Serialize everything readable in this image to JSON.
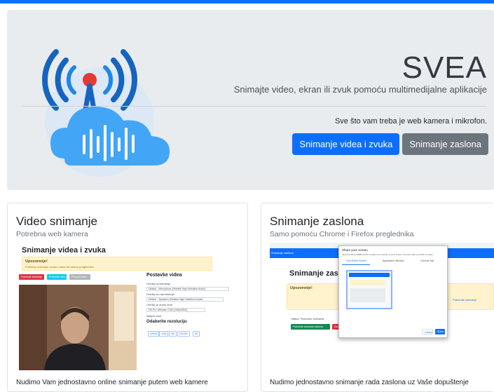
{
  "hero": {
    "title": "SVEA",
    "lead": "Snimajte video, ekran ili zvuk pomoću multimedijalne aplikacije",
    "text": "Sve što vam treba je web kamera i mikrofon.",
    "buttons": {
      "video_audio": "Snimanje videa i zvuka",
      "screen": "Snimanje zaslona"
    }
  },
  "cards": {
    "video": {
      "title": "Video snimanje",
      "subtitle": "Potrebna web kamera",
      "text": "Nudimo Vam jednostavno online snimanje putem web kamere",
      "preview": {
        "heading": "Snimanje videa i zvuka",
        "alert_title": "Upozorenje!",
        "alert_text": "Potrebno snimanje zvuka i videa na vašem pregledniku",
        "buttons": [
          "Pokrenite snimanje",
          "Pokrenite video",
          "Preuzmi video"
        ],
        "settings_title": "Postavke videa",
        "labels": [
          "Uređaj za snimanje",
          "Uređaj za reprodukciju",
          "Uređaj za audio izvor"
        ],
        "selects": [
          "Default - Microphone (Realtek High Definition Audio)",
          "Default - Speakers (Realtek High Definition Audio)",
          "HD Pro Webcam C920 (046d:082d)"
        ],
        "checkbox_label": "Isključi zvuk",
        "resolution_title": "Odaberite rezoluciju",
        "resolutions": [
          "QVGA",
          "VGA",
          "HD",
          "Full HD",
          "4K"
        ]
      }
    },
    "screen": {
      "title": "Snimanje zaslona",
      "subtitle": "Samo pomoću Chrome i Firefox preglednika",
      "text": "Nudimo jednostavno snimanje rada zaslona uz Vaše dopuštenje",
      "preview": {
        "heading": "Snimanje zaslo",
        "nav_item": "Snimanje zaslona",
        "dialog_title": "Share your screen",
        "dialog_sub": "https://localhost:8080 wants to share the contents of your screen. Choose what you'd like to share.",
        "tabs": [
          "Your Entire Screen",
          "Application Window",
          "Chrome Tab"
        ],
        "dialog_buttons": [
          "Share",
          "Cancel"
        ],
        "alert_title": "Upozorenje!",
        "status_label": "Status: Pokrenite snimanje",
        "buttons": [
          "Pokrenite snimanje zaslona",
          "Zaustavi"
        ],
        "right_link": "Pokrenite snimanje"
      }
    }
  },
  "colors": {
    "primary": "#0d6efd",
    "secondary": "#6c757d",
    "hero_bg": "#e9ecef",
    "warning_bg": "#fff3cd",
    "danger": "#dc3545",
    "info": "#0dcaf0",
    "success": "#198754"
  }
}
